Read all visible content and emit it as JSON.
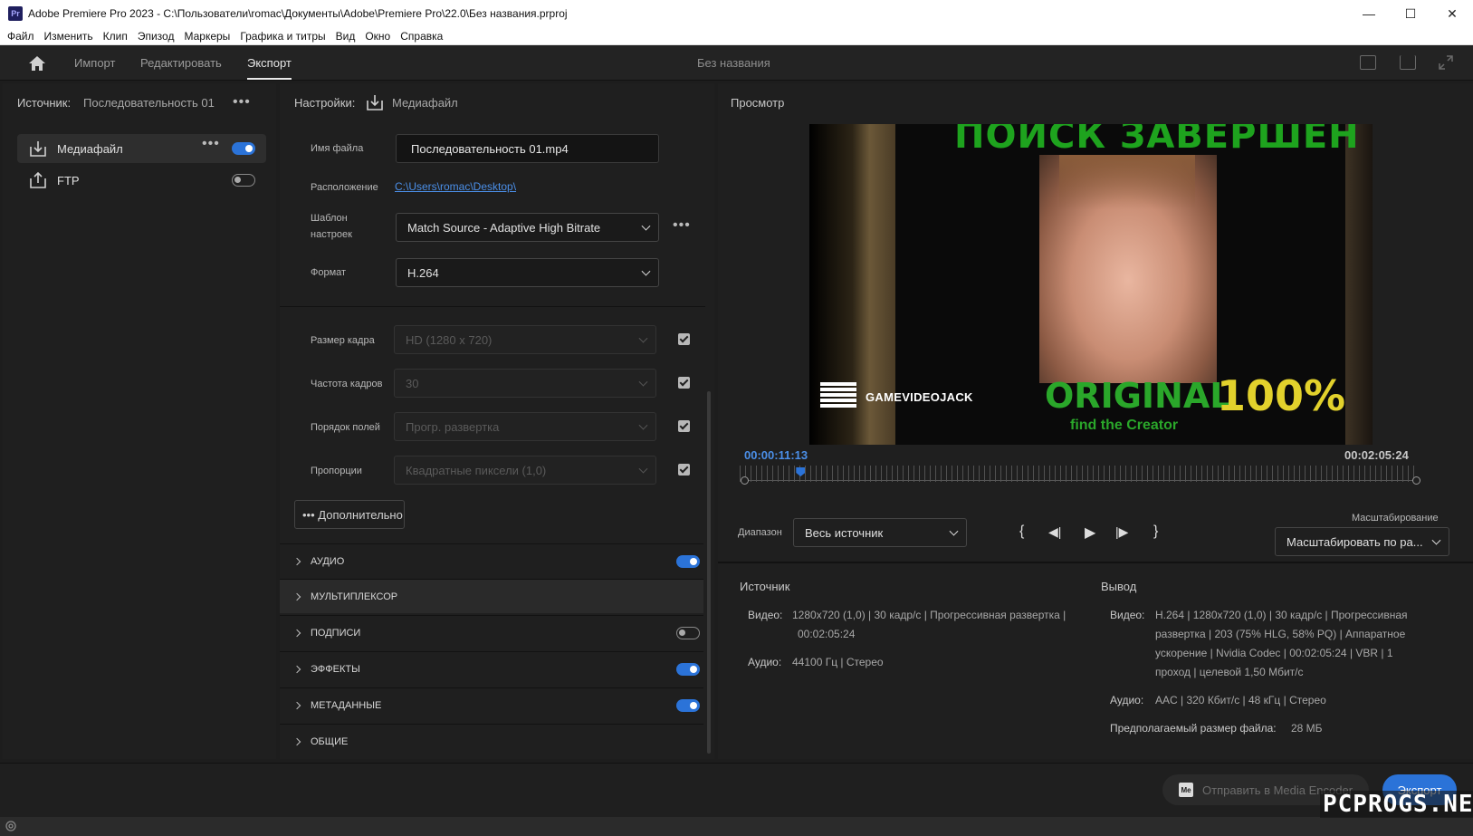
{
  "window": {
    "title": "Adobe Premiere Pro 2023 - C:\\Пользователи\\romac\\Документы\\Adobe\\Premiere Pro\\22.0\\Без названия.prproj",
    "app_icon": "Pr",
    "minimize": "—",
    "maximize": "☐",
    "close": "✕"
  },
  "menu": [
    "Файл",
    "Изменить",
    "Клип",
    "Эпизод",
    "Маркеры",
    "Графика и титры",
    "Вид",
    "Окно",
    "Справка"
  ],
  "header": {
    "tabs": [
      "Импорт",
      "Редактировать",
      "Экспорт"
    ],
    "active_tab": "Экспорт",
    "doc_title": "Без названия"
  },
  "source": {
    "label": "Источник:",
    "sequence": "Последовательность 01",
    "more": "•••",
    "destinations": [
      {
        "label": "Медиафайл",
        "enabled": true,
        "icon": "media-file-icon"
      },
      {
        "label": "FTP",
        "enabled": false,
        "icon": "ftp-upload-icon"
      }
    ]
  },
  "settings": {
    "label": "Настройки:",
    "destination": "Медиафайл",
    "filename_label": "Имя файла",
    "filename": "Последовательность 01.mp4",
    "location_label": "Расположение",
    "location": "C:\\Users\\romac\\Desktop\\",
    "preset_label_1": "Шаблон",
    "preset_label_2": "настроек",
    "preset": "Match Source - Adaptive High Bitrate",
    "format_label": "Формат",
    "format": "H.264",
    "video_fields": [
      {
        "label": "Размер кадра",
        "value": "HD (1280 x 720)",
        "checked": true
      },
      {
        "label": "Частота кадров",
        "value": "30",
        "checked": true
      },
      {
        "label": "Порядок полей",
        "value": "Прогр. развертка",
        "checked": true
      },
      {
        "label": "Пропорции",
        "value": "Квадратные пиксели (1,0)",
        "checked": true
      }
    ],
    "advanced": "••• Дополнительно",
    "sections": [
      {
        "name": "АУДИО",
        "toggle": "on"
      },
      {
        "name": "МУЛЬТИПЛЕКСОР",
        "toggle": "none"
      },
      {
        "name": "ПОДПИСИ",
        "toggle": "off"
      },
      {
        "name": "ЭФФЕКТЫ",
        "toggle": "on"
      },
      {
        "name": "МЕТАДАННЫЕ",
        "toggle": "on"
      },
      {
        "name": "ОБЩИЕ",
        "toggle": "none"
      }
    ]
  },
  "preview": {
    "title": "Просмотр",
    "video_text": {
      "top": "ПОИСК ЗАВЕРШЕН",
      "original": "ORIGINAL",
      "percent": "100%",
      "creator": "find the Creator",
      "brand": "GAMEVIDEOJACK"
    },
    "timecode_current": "00:00:11:13",
    "timecode_total": "00:02:05:24",
    "playhead_fraction": 0.09,
    "range_label": "Диапазон",
    "range_value": "Весь источник",
    "scale_label": "Масштабирование",
    "scale_value": "Масштабировать по ра...",
    "controls": [
      "{",
      "◀|",
      "▶",
      "|▶",
      "}"
    ]
  },
  "info": {
    "source_title": "Источник",
    "output_title": "Вывод",
    "src_video_label": "Видео:",
    "src_video_l1": "1280x720 (1,0)  |  30 кадр/с  |  Прогрессивная развертка  |",
    "src_video_l2": "00:02:05:24",
    "src_audio_label": "Аудио:",
    "src_audio": "44100 Гц  |  Стерео",
    "out_video_label": "Видео:",
    "out_video_l1": "H.264  |  1280x720 (1,0)  |  30 кадр/с  |  Прогрессивная",
    "out_video_l2": "развертка  |  203 (75% HLG, 58% PQ)  |  Аппаратное",
    "out_video_l3": "ускорение  |  Nvidia Codec  |  00:02:05:24  |  VBR  |  1",
    "out_video_l4": "проход  |  целевой 1,50 Мбит/с",
    "out_audio_label": "Аудио:",
    "out_audio": "AAC  |  320 Кбит/с  |  48 кГц  |  Стерео",
    "size_label": "Предполагаемый размер файла:",
    "size_value": "28 МБ"
  },
  "footer": {
    "media_encoder_icon": "Me",
    "media_encoder": "Отправить в Media Encoder",
    "export": "Экспорт"
  },
  "watermark": "PCPROGS.NET",
  "colors": {
    "accent": "#2b73d8",
    "link": "#4b8fe8",
    "panel": "#1f1f1f"
  }
}
